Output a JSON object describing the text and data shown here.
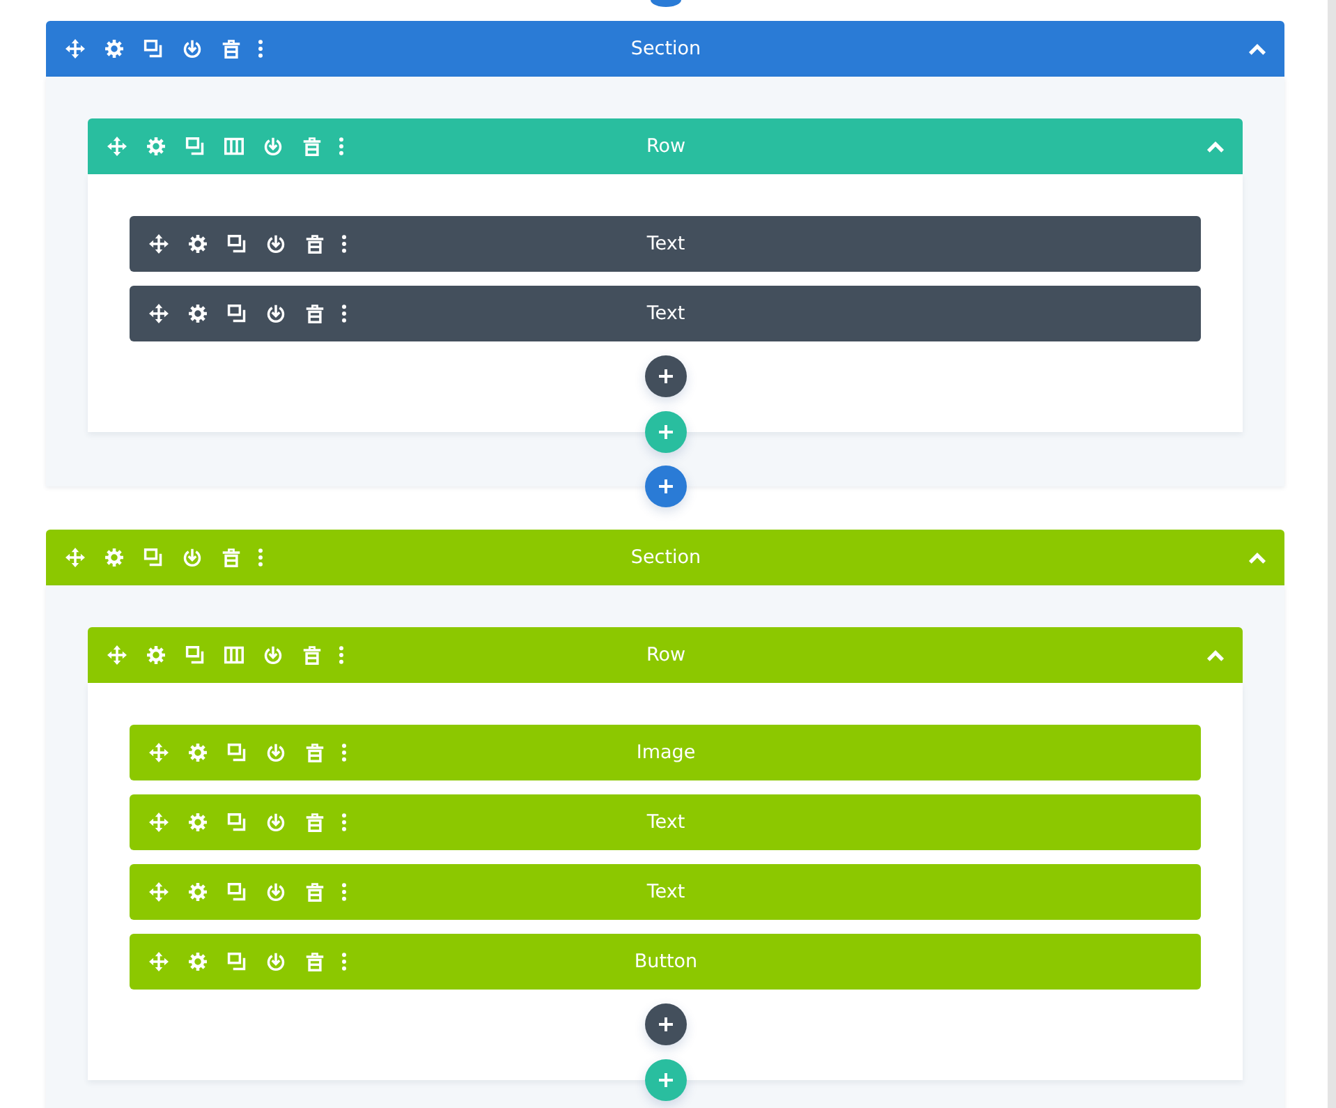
{
  "sections": [
    {
      "title": "Section",
      "color": "#2a7bd6",
      "expanded": true,
      "rows": [
        {
          "title": "Row",
          "color": "#29be9f",
          "expanded": true,
          "modules": [
            {
              "title": "Text",
              "color": "#434f5c"
            },
            {
              "title": "Text",
              "color": "#434f5c"
            }
          ]
        }
      ]
    },
    {
      "title": "Section",
      "color": "#8cc800",
      "expanded": true,
      "rows": [
        {
          "title": "Row",
          "color": "#8cc800",
          "expanded": true,
          "modules": [
            {
              "title": "Image",
              "color": "#8cc800"
            },
            {
              "title": "Text",
              "color": "#8cc800"
            },
            {
              "title": "Text",
              "color": "#8cc800"
            },
            {
              "title": "Button",
              "color": "#8cc800"
            }
          ]
        }
      ]
    }
  ]
}
